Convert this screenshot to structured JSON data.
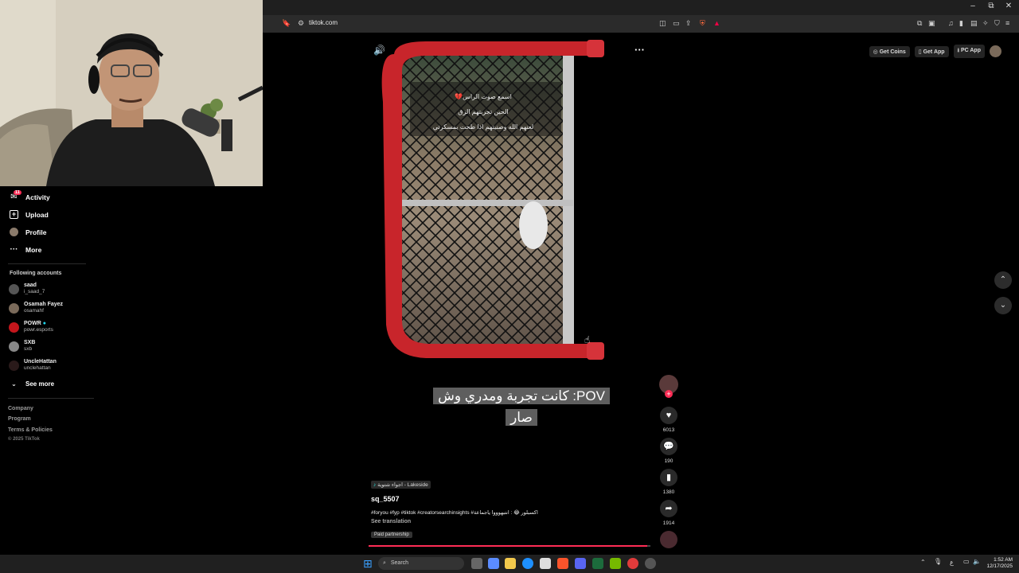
{
  "browser": {
    "url": "tiktok.com",
    "window_controls": {
      "minimize": "–",
      "restore": "⧉",
      "close": "✕"
    }
  },
  "sidebar": {
    "nav": [
      {
        "label": "Activity",
        "icon": "inbox-icon",
        "badge": "11"
      },
      {
        "label": "Upload",
        "icon": "plus-square-icon"
      },
      {
        "label": "Profile",
        "icon": "avatar-icon"
      },
      {
        "label": "More",
        "icon": "more-dots-icon"
      }
    ],
    "following_title": "Following accounts",
    "accounts": [
      {
        "name": "saad",
        "handle": "i_saad_7"
      },
      {
        "name": "Osamah Fayez",
        "handle": "osamahf"
      },
      {
        "name": "POWR",
        "handle": "powr.esports",
        "verified": true
      },
      {
        "name": "SXB",
        "handle": "sxb"
      },
      {
        "name": "UncleHattan",
        "handle": "unclehattan"
      }
    ],
    "see_more": "See more",
    "footer": {
      "company": "Company",
      "program": "Program",
      "terms": "Terms & Policies",
      "copyright": "© 2025 TikTok"
    }
  },
  "top_buttons": {
    "coins": "Get Coins",
    "app": "Get App",
    "pc_app": "PC App"
  },
  "video": {
    "overlay_lines": [
      "اسمع صوت الراس💔",
      "الحين تجربتهم الزق",
      "لعنهم الله وصنيتهم اذا طحت بمسكرتي"
    ],
    "caption": "POV: كانت تجربة ومدري وش صار",
    "sound": "اجواء شتوية - Lakeside",
    "username": "sq_5507",
    "description": "#foryou #fyp #tiktok #creatorsearchinsights #اكسبلور 😂 : انتبهوووا ياجماعة",
    "see_translation": "See translation",
    "paid_tag": "Paid partnership",
    "progress_fraction": 0.99
  },
  "actions": {
    "likes": "6013",
    "comments": "190",
    "saves": "1380",
    "shares": "1914"
  },
  "taskbar": {
    "search_placeholder": "Search",
    "time": "1:52 AM",
    "date": "12/17/2025",
    "lang": "ع"
  },
  "colors": {
    "accent": "#fe2c55",
    "frame_red": "#c8252b"
  }
}
